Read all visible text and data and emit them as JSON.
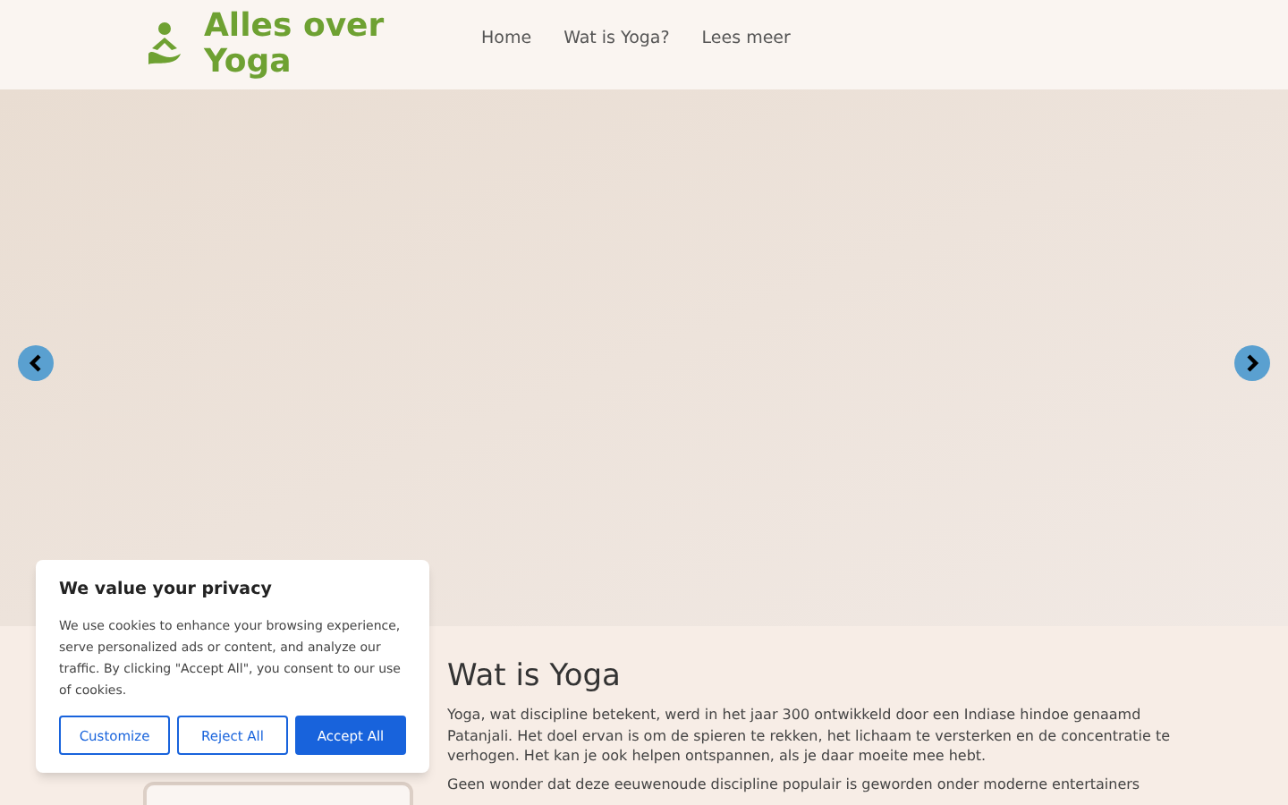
{
  "site": {
    "title": "Alles over Yoga"
  },
  "nav": [
    {
      "label": "Home"
    },
    {
      "label": "Wat is Yoga?"
    },
    {
      "label": "Lees meer"
    }
  ],
  "article": {
    "heading": "Wat is Yoga",
    "paragraphs": [
      "Yoga, wat discipline betekent, werd in het jaar 300 ontwikkeld door een Indiase hindoe genaamd Patanjali. Het doel ervan is om de spieren te rekken, het lichaam te versterken en de concentratie te verhogen. Het kan je ook helpen ontspannen, als je daar moeite mee hebt.",
      "Geen wonder dat deze eeuwenoude discipline populair is geworden onder moderne entertainers"
    ]
  },
  "cookie_banner": {
    "title": "We value your privacy",
    "text": "We use cookies to enhance your browsing experience, serve personalized ads or content, and analyze our traffic. By clicking \"Accept All\", you consent to our use of cookies.",
    "buttons": [
      {
        "label": "Customize",
        "kind": "outline"
      },
      {
        "label": "Reject All",
        "kind": "outline"
      },
      {
        "label": "Accept All",
        "kind": "primary"
      }
    ]
  }
}
